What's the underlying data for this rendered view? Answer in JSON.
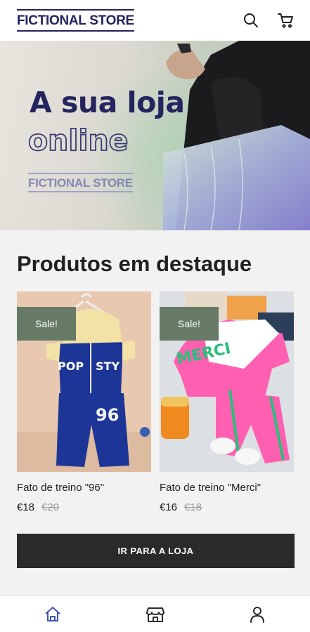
{
  "header": {
    "logo_text": "FICTIONAL STORE",
    "icons": [
      "search-icon",
      "cart-icon"
    ]
  },
  "hero": {
    "title_line1": "A sua loja",
    "title_line2": "online",
    "logo_text": "FICTIONAL STORE"
  },
  "featured": {
    "title": "Produtos em destaque",
    "products": [
      {
        "name": "Fato de treino \"96\"",
        "price": "€18",
        "old_price": "€20",
        "badge": "Sale!"
      },
      {
        "name": "Fato de treino \"Merci\"",
        "price": "€16",
        "old_price": "€18",
        "badge": "Sale!"
      }
    ],
    "button_label": "IR PARA A LOJA"
  },
  "bottom_nav": {
    "items": [
      "home-icon",
      "store-icon",
      "account-icon"
    ],
    "active": "home-icon"
  },
  "colors": {
    "brand_navy": "#23235e",
    "sale_badge": "#667a65",
    "button_dark": "#2a2a2a",
    "active_nav": "#3f51b5"
  }
}
